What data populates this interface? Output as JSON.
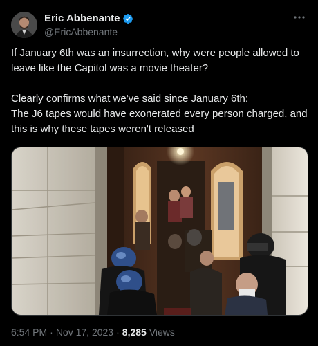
{
  "author": {
    "display_name": "Eric Abbenante",
    "handle": "@EricAbbenante",
    "verified": true,
    "verified_color": "#1d9bf0"
  },
  "tweet": {
    "line1": "If January 6th was an insurrection, why were people allowed to leave like the Capitol was a movie theater?",
    "line2": "Clearly confirms what we've said since January 6th:",
    "line3": "The J6 tapes would have exonerated every person charged, and this is why these tapes weren't released"
  },
  "media": {
    "type": "image"
  },
  "meta": {
    "time": "6:54 PM",
    "separator": "·",
    "date": "Nov 17, 2023",
    "views_count": "8,285",
    "views_label": "Views"
  },
  "icons": {
    "more": "more-options-icon",
    "verified": "verified-badge-icon"
  }
}
